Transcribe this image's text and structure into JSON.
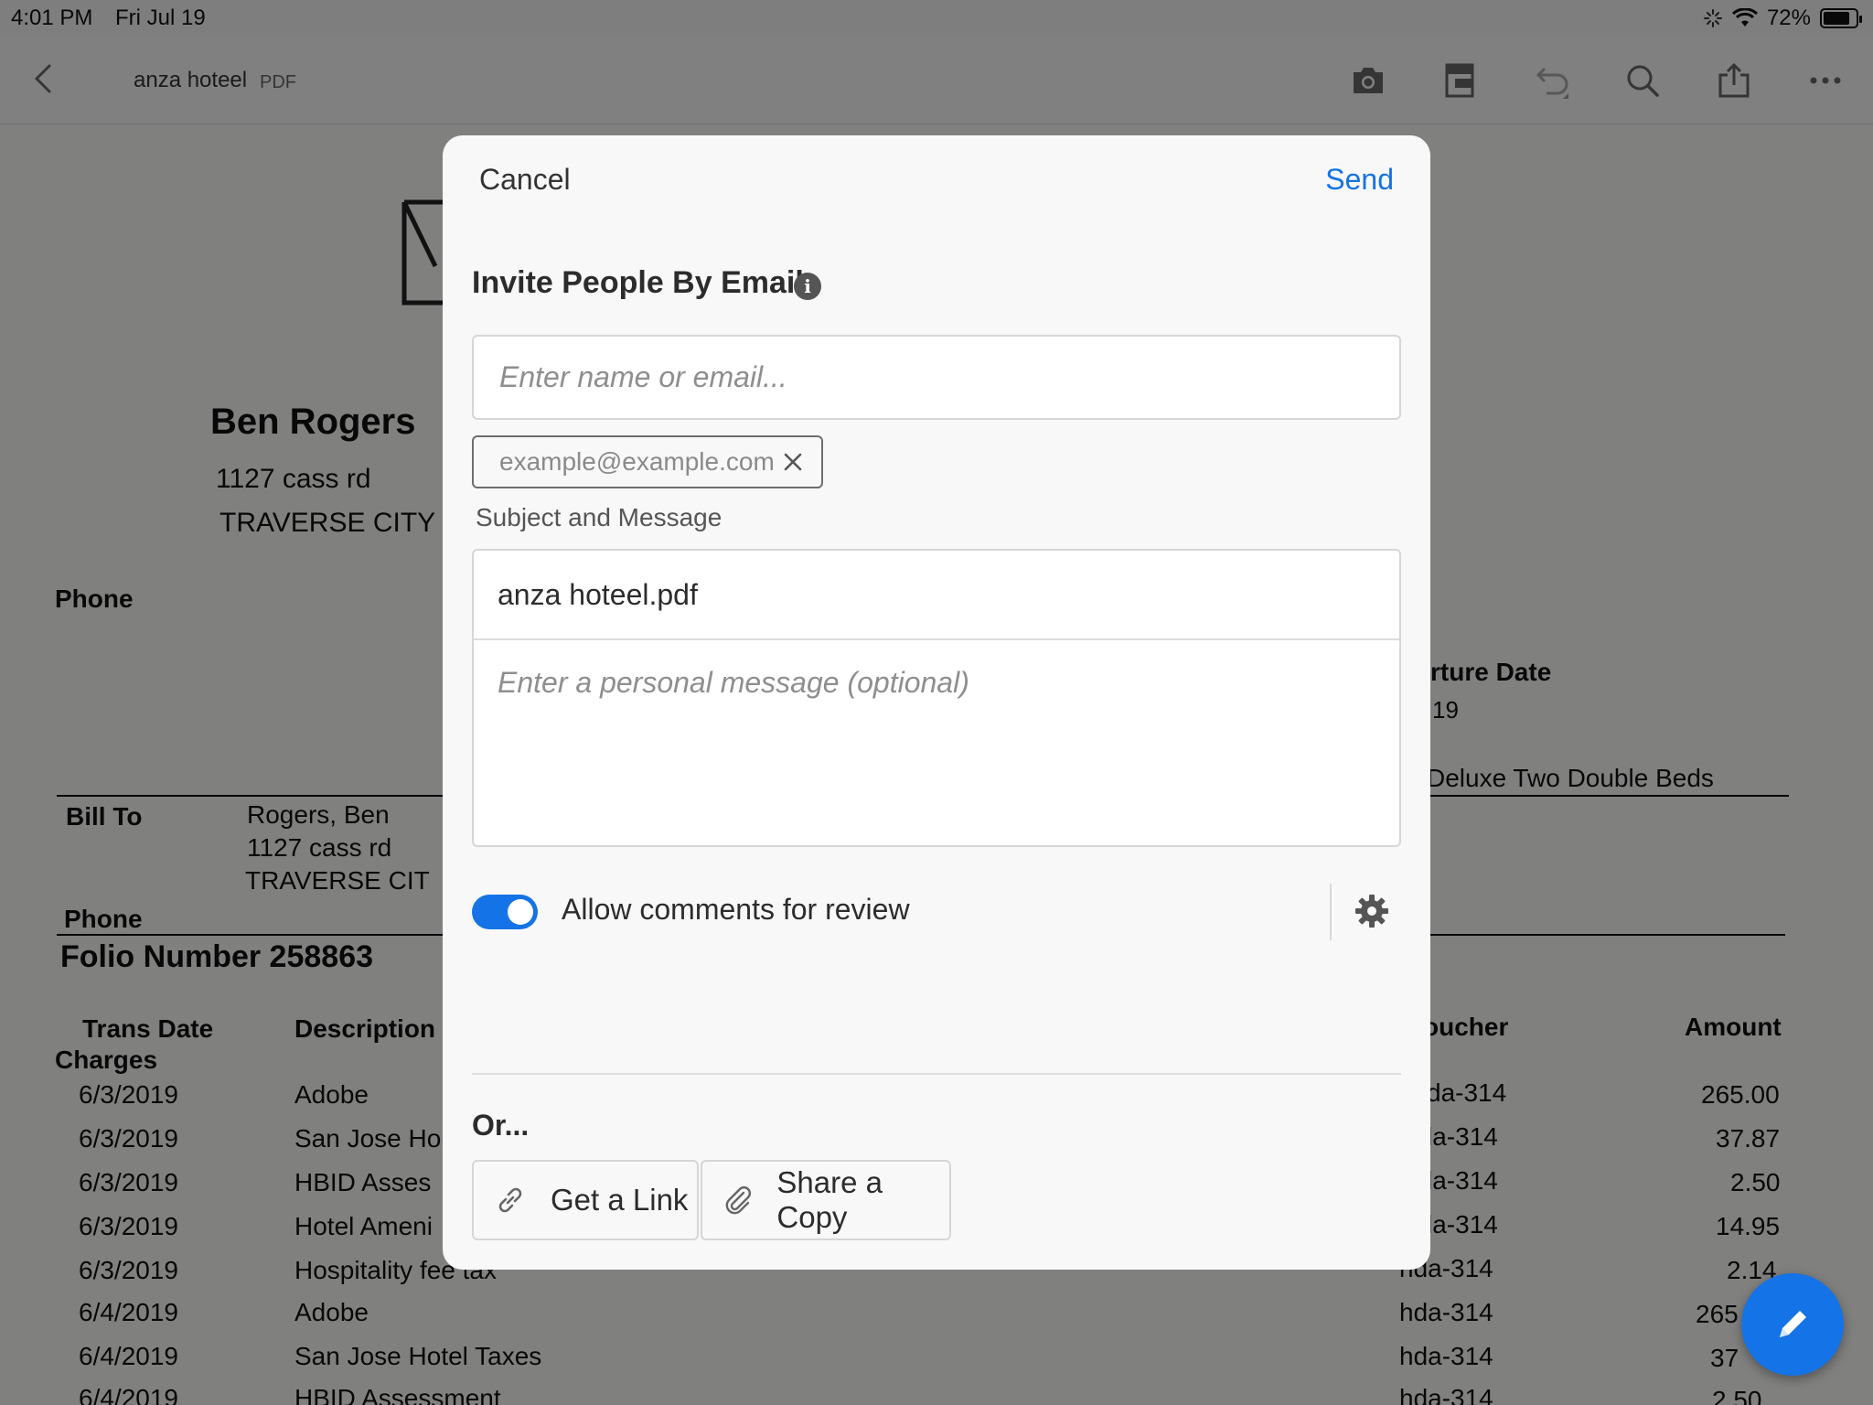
{
  "status_bar": {
    "time": "4:01 PM",
    "date": "Fri Jul 19",
    "battery": "72%"
  },
  "toolbar": {
    "doc_title": "anza hoteel",
    "doc_type": "PDF"
  },
  "document": {
    "guest_name": "Ben Rogers",
    "guest_address1": "1127 cass rd",
    "guest_address2": "TRAVERSE CITY",
    "phone_label": "Phone",
    "departure_label": "rture Date",
    "departure_value": "19",
    "room_type": "Deluxe Two Double Beds",
    "bill_to_label": "Bill To",
    "bill_to_name": "Rogers, Ben",
    "bill_to_address1": "1127 cass rd",
    "bill_to_address2": "TRAVERSE CIT",
    "phone_label2": "Phone",
    "folio": "Folio Number 258863",
    "columns": {
      "trans_date": "Trans Date",
      "charges": "Charges",
      "description": "Description",
      "voucher": "oucher",
      "amount": "Amount"
    },
    "rows": [
      {
        "date": "6/3/2019",
        "desc": "Adobe",
        "voucher": "da-314",
        "amount": "265.00"
      },
      {
        "date": "6/3/2019",
        "desc": "San Jose Ho",
        "voucher": "la-314",
        "amount": "37.87"
      },
      {
        "date": "6/3/2019",
        "desc": "HBID Asses",
        "voucher": "la-314",
        "amount": "2.50"
      },
      {
        "date": "6/3/2019",
        "desc": "Hotel Ameni",
        "voucher": "la-314",
        "amount": "14.95"
      },
      {
        "date": "6/3/2019",
        "desc": "Hospitality fee tax",
        "voucher": "hda-314",
        "amount": "2.14"
      },
      {
        "date": "6/4/2019",
        "desc": "Adobe",
        "voucher": "hda-314",
        "amount": "265"
      },
      {
        "date": "6/4/2019",
        "desc": "San Jose Hotel Taxes",
        "voucher": "hda-314",
        "amount": "37"
      },
      {
        "date": "6/4/2019",
        "desc": "HBID Assessment",
        "voucher": "hda-314",
        "amount": "2.50"
      }
    ]
  },
  "dialog": {
    "cancel_label": "Cancel",
    "send_label": "Send",
    "heading": "Invite People By Email",
    "email_placeholder": "Enter name or email...",
    "recipient_chip": "example@example.com",
    "subject_label": "Subject and Message",
    "subject_value": "anza hoteel.pdf",
    "message_placeholder": "Enter a personal message (optional)",
    "allow_comments_label": "Allow comments for review",
    "allow_comments_enabled": true,
    "or_label": "Or...",
    "get_link_label": "Get a Link",
    "share_copy_label": "Share a Copy"
  },
  "colors": {
    "accent": "#1473e6",
    "overlay": "rgba(0,0,0,0.48)"
  }
}
